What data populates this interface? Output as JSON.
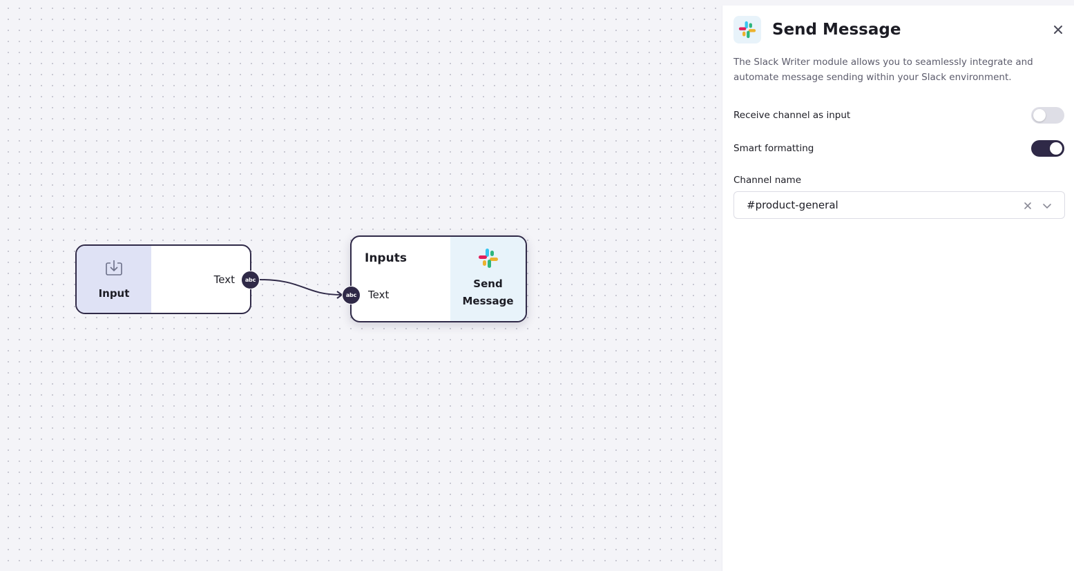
{
  "canvas": {
    "nodes": {
      "input": {
        "label": "Input",
        "icon": "input-tray-icon",
        "output_port": {
          "label": "Text",
          "type_badge": "abc"
        }
      },
      "send_message": {
        "section_title": "Inputs",
        "label": "Send Message",
        "icon": "slack-logo-icon",
        "input_port": {
          "label": "Text",
          "type_badge": "abc"
        }
      }
    }
  },
  "panel": {
    "title": "Send Message",
    "logo_icon": "slack-logo-icon",
    "close_icon": "close-icon",
    "description": "The Slack Writer module allows you to seamlessly integrate and automate message sending within your Slack environment.",
    "settings": [
      {
        "label": "Receive channel as input",
        "enabled": false
      },
      {
        "label": "Smart formatting",
        "enabled": true
      }
    ],
    "channel": {
      "label": "Channel name",
      "value": "#product-general"
    }
  },
  "colors": {
    "node_border": "#2f2947",
    "input_node_fill": "#dfe2f5",
    "send_node_fill": "#e8f3fa",
    "toggle_on": "#2f2947",
    "toggle_off": "#dedee6"
  }
}
